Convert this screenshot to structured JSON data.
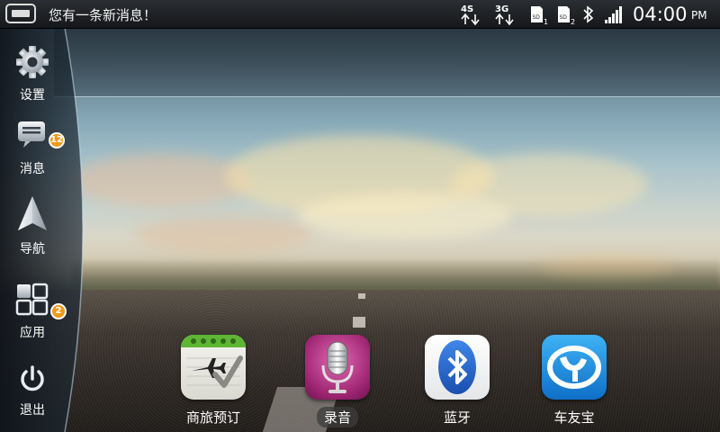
{
  "status_bar": {
    "message": "您有一条新消息！",
    "net_4s": "4S",
    "net_3g": "3G",
    "sd1_label": "SD",
    "sd1_index": "1",
    "sd2_label": "SD",
    "sd2_index": "2",
    "time": "04:00",
    "ampm": "PM"
  },
  "sidebar": {
    "settings": {
      "label": "设置"
    },
    "messages": {
      "label": "消息",
      "badge": "12"
    },
    "navigation": {
      "label": "导航"
    },
    "apps": {
      "label": "应用",
      "badge": "2"
    },
    "exit": {
      "label": "退出"
    }
  },
  "dock": {
    "travel": {
      "label": "商旅预订"
    },
    "recorder": {
      "label": "录音"
    },
    "bluetooth": {
      "label": "蓝牙"
    },
    "carpal": {
      "label": "车友宝"
    }
  },
  "colors": {
    "badge": "#f09a1a",
    "bluetooth_blue": "#1f63c8",
    "carpal_blue": "#1b8fe0",
    "recorder_purple": "#b2307f",
    "travel_green": "#5fb534"
  }
}
